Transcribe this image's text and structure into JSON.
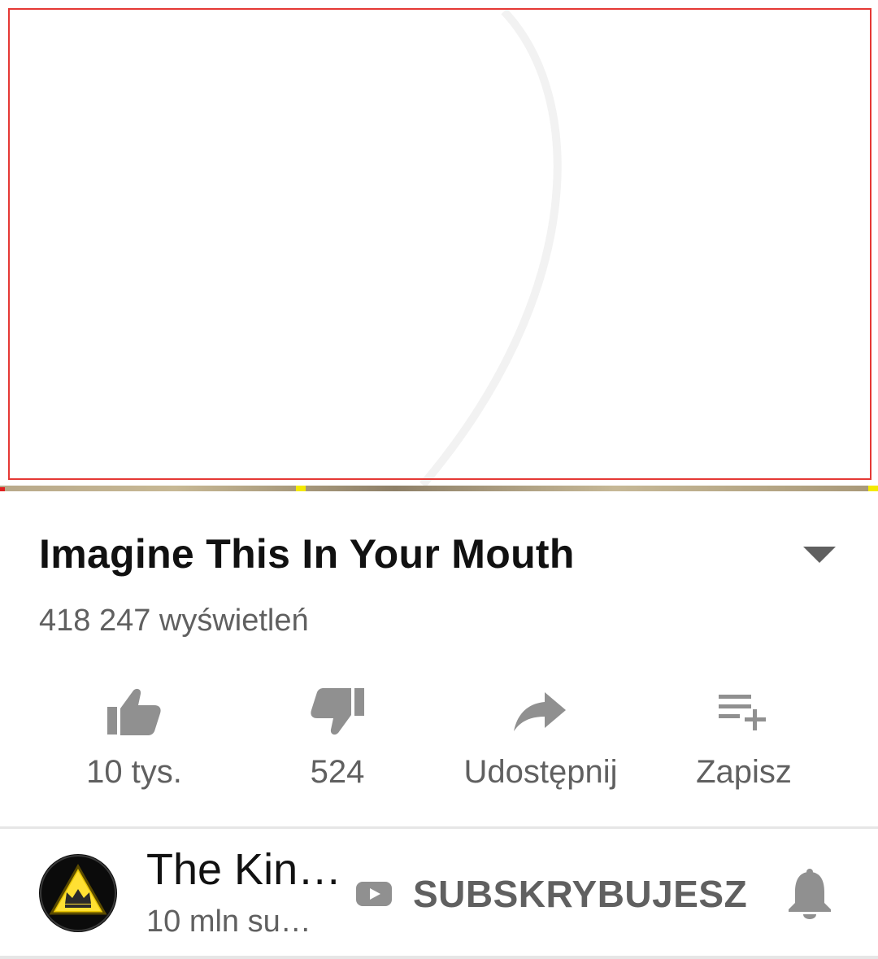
{
  "video": {
    "title": "Imagine This In Your Mouth",
    "views": "418 247 wyświetleń"
  },
  "actions": {
    "like": {
      "label": "10 tys.",
      "icon": "thumb-up-icon"
    },
    "dislike": {
      "label": "524",
      "icon": "thumb-down-icon"
    },
    "share": {
      "label": "Udostępnij",
      "icon": "share-icon"
    },
    "save": {
      "label": "Zapisz",
      "icon": "playlist-add-icon"
    }
  },
  "channel": {
    "name": "The Kin…",
    "subscribers": "10 mln su…",
    "subscribe_label": "SUBSKRYBUJESZ"
  },
  "colors": {
    "text_primary": "#111111",
    "text_secondary": "#606060",
    "icon_gray": "#909090",
    "player_outline": "#e53935",
    "progress_marker": "#f4e900"
  }
}
